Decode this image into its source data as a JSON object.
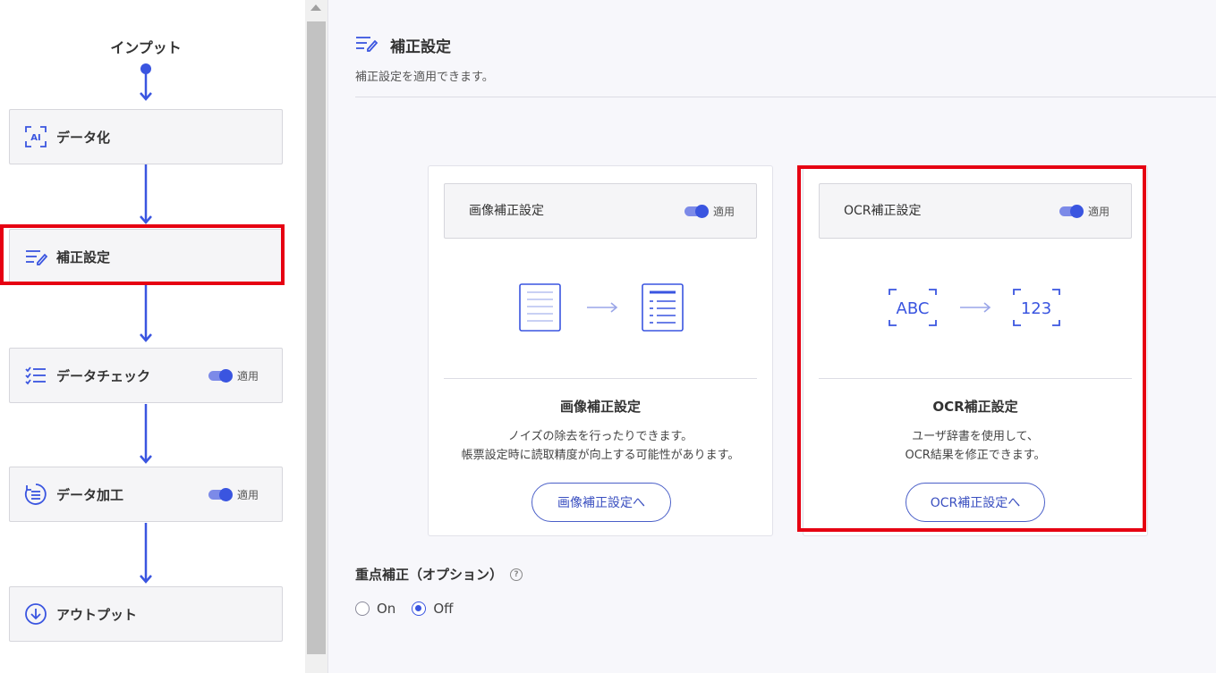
{
  "flow": {
    "input_label": "インプット",
    "steps": [
      {
        "label": "データ化",
        "icon": "ai-scan-icon"
      },
      {
        "label": "補正設定",
        "icon": "edit-list-icon"
      },
      {
        "label": "データチェック",
        "icon": "checklist-icon",
        "toggle_label": "適用"
      },
      {
        "label": "データ加工",
        "icon": "process-list-icon",
        "toggle_label": "適用"
      },
      {
        "label": "アウトプット",
        "icon": "download-icon"
      }
    ]
  },
  "header": {
    "title": "補正設定",
    "description": "補正設定を適用できます。"
  },
  "panels": [
    {
      "head_title": "画像補正設定",
      "toggle_label": "適用",
      "name": "画像補正設定",
      "desc_line1": "ノイズの除去を行ったりできます。",
      "desc_line2": "帳票設定時に読取精度が向上する可能性があります。",
      "button_label": "画像補正設定へ"
    },
    {
      "head_title": "OCR補正設定",
      "toggle_label": "適用",
      "from_text": "ABC",
      "to_text": "123",
      "name": "OCR補正設定",
      "desc_line1": "ユーザ辞書を使用して、",
      "desc_line2": "OCR結果を修正できます。",
      "button_label": "OCR補正設定へ"
    }
  ],
  "option": {
    "title": "重点補正（オプション）",
    "help_glyph": "?",
    "on_label": "On",
    "off_label": "Off",
    "selected": "Off"
  },
  "colors": {
    "accent": "#3a55e0",
    "highlight": "#e60012"
  }
}
